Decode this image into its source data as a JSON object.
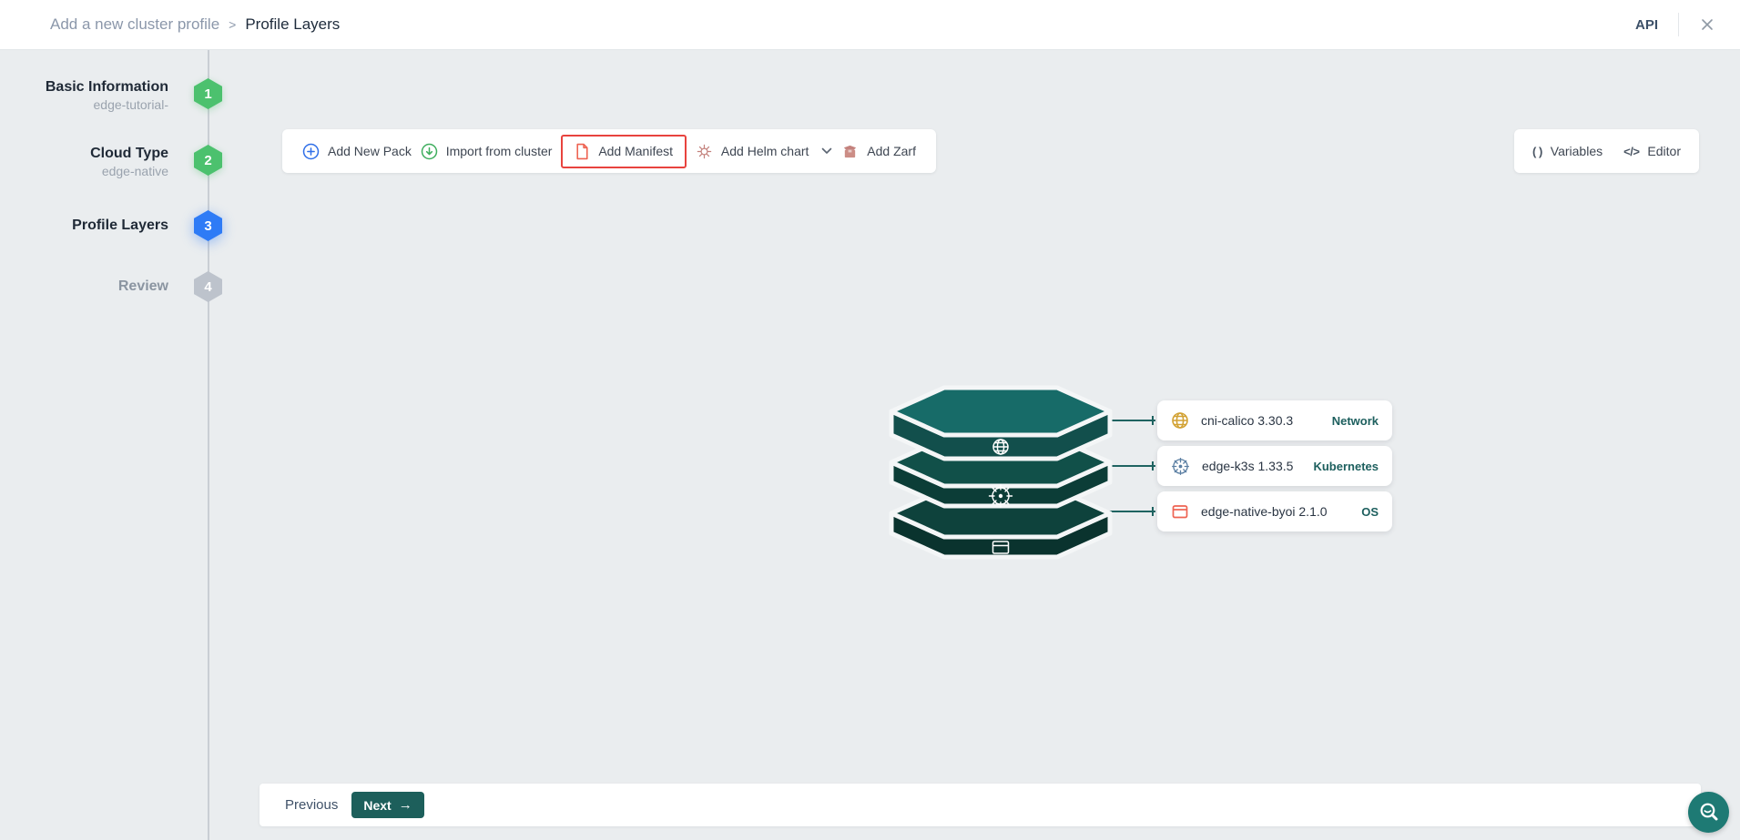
{
  "header": {
    "breadcrumb": {
      "parent": "Add a new cluster profile",
      "separator": ">",
      "current": "Profile Layers"
    },
    "api_label": "API"
  },
  "stepper": {
    "steps": [
      {
        "number": "1",
        "label": "Basic Information",
        "sublabel": "edge-tutorial-",
        "state": "done"
      },
      {
        "number": "2",
        "label": "Cloud Type",
        "sublabel": "edge-native",
        "state": "done"
      },
      {
        "number": "3",
        "label": "Profile Layers",
        "sublabel": "",
        "state": "active"
      },
      {
        "number": "4",
        "label": "Review",
        "sublabel": "",
        "state": "pending"
      }
    ]
  },
  "toolbar": {
    "add_new_pack": "Add New Pack",
    "import_from_cluster": "Import from cluster",
    "add_manifest": "Add Manifest",
    "add_helm_chart": "Add Helm chart",
    "add_zarf": "Add Zarf"
  },
  "side_actions": {
    "variables_icon": "( )",
    "variables_label": "Variables",
    "editor_icon": "</>",
    "editor_label": "Editor"
  },
  "profile_stack": {
    "cards": [
      {
        "name": "cni-calico 3.30.3",
        "type": "Network",
        "icon": "globe-icon"
      },
      {
        "name": "edge-k3s 1.33.5",
        "type": "Kubernetes",
        "icon": "kubernetes-icon"
      },
      {
        "name": "edge-native-byoi 2.1.0",
        "type": "OS",
        "icon": "os-window-icon"
      }
    ]
  },
  "footer": {
    "previous_label": "Previous",
    "next_label": "Next",
    "next_arrow": "→"
  },
  "colors": {
    "step_done": "#4cc16e",
    "step_active": "#2e7bf6",
    "step_pending": "#bdc3cc",
    "accent_teal": "#1d5f5b",
    "highlight_red": "#e8433e",
    "layer_top_face": "#176b68",
    "layer_mid_face": "#115049",
    "layer_bottom_face": "#0e423c",
    "card_type_color": "#1d5f5e",
    "add_pack_blue": "#2f6fe8",
    "import_green": "#3fae5e",
    "manifest_coral": "#ee6352",
    "helm_rose": "#c4827d",
    "globe_gold": "#d2a132",
    "k8s_slate": "#5b7fa3"
  }
}
